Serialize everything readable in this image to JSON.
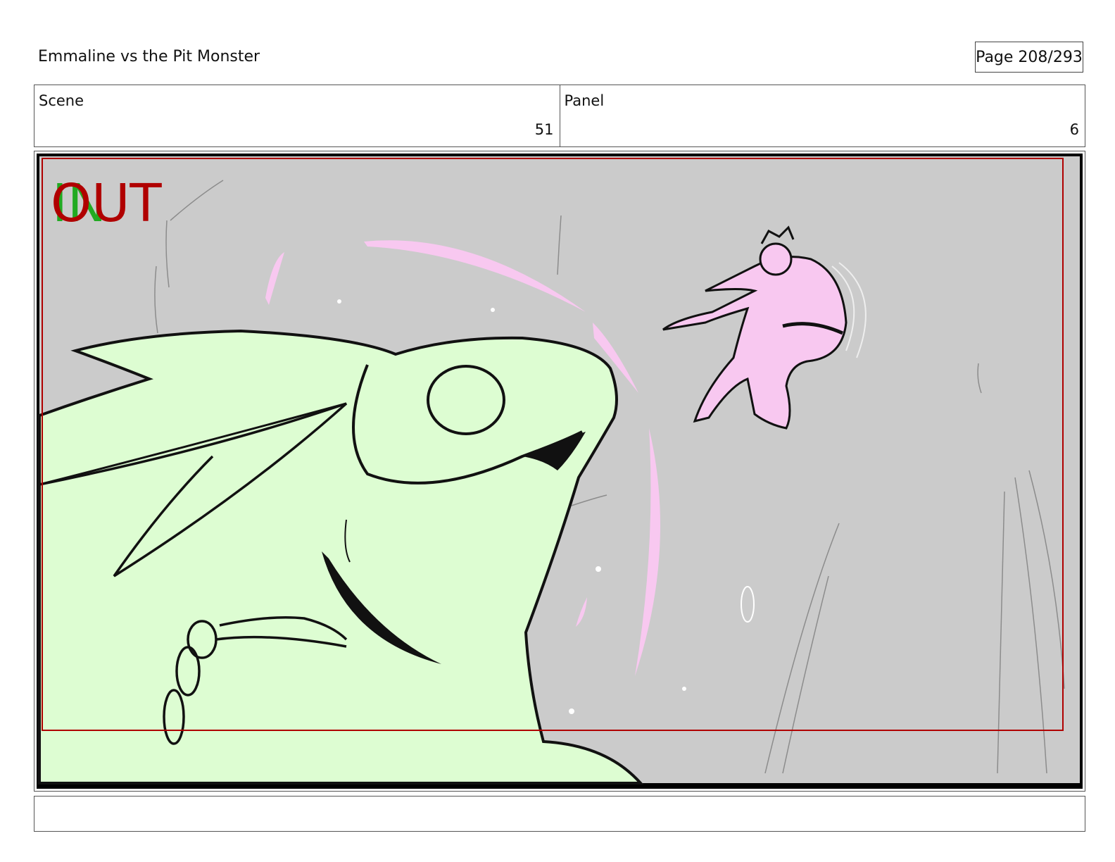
{
  "header": {
    "title": "Emmaline vs the Pit Monster",
    "page_label": "Page 208/293"
  },
  "info": {
    "scene_label": "Scene",
    "scene_value": "51",
    "panel_label": "Panel",
    "panel_value": "6"
  },
  "panel": {
    "in_marker": "IN",
    "out_marker": "OUT",
    "background_color": "#cbcbcb",
    "monster_fill": "#ddfdd2",
    "character_fill": "#f8c8f0",
    "frame_line_color": "#b00000",
    "in_color": "#22aa22",
    "out_color": "#b00000"
  },
  "notes": {
    "text": ""
  }
}
